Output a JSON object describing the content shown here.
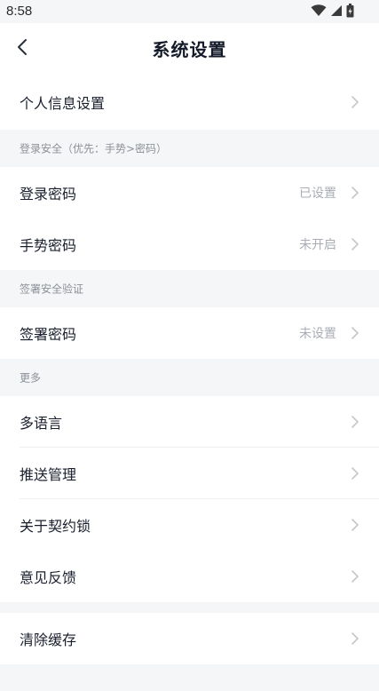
{
  "status_bar": {
    "time": "8:58",
    "icons": [
      "wifi-icon",
      "signal-icon",
      "battery-icon"
    ]
  },
  "header": {
    "title": "系统设置",
    "back_icon": "chevron-left-icon"
  },
  "rows": {
    "personal_info": {
      "label": "个人信息设置"
    },
    "login_password": {
      "label": "登录密码",
      "value": "已设置"
    },
    "gesture_password": {
      "label": "手势密码",
      "value": "未开启"
    },
    "sign_password": {
      "label": "签署密码",
      "value": "未设置"
    },
    "language": {
      "label": "多语言"
    },
    "push": {
      "label": "推送管理"
    },
    "about": {
      "label": "关于契约锁"
    },
    "feedback": {
      "label": "意见反馈"
    },
    "clear_cache": {
      "label": "清除缓存"
    }
  },
  "sections": {
    "login_security": "登录安全（优先：手势>密码）",
    "sign_verify": "签署安全验证",
    "more": "更多"
  },
  "colors": {
    "background": "#f5f6f7",
    "row_bg": "#ffffff",
    "text": "#1a1f2e",
    "muted": "#a9adb4",
    "chevron": "#c4c7cc"
  }
}
